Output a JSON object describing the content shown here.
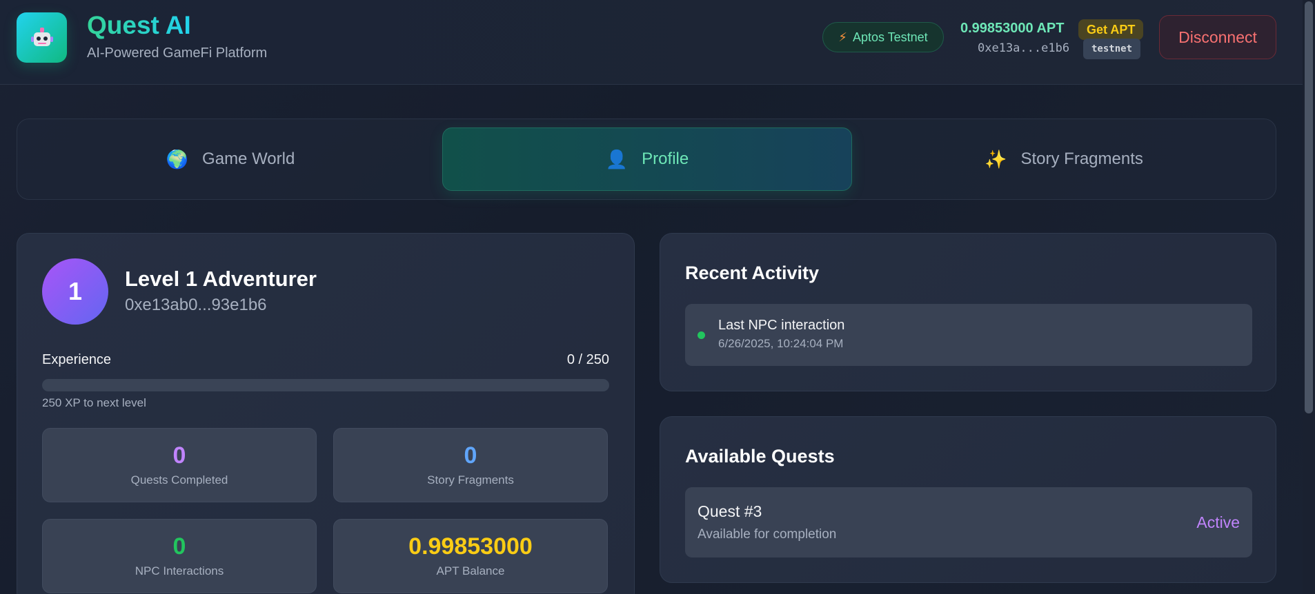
{
  "header": {
    "title": "Quest AI",
    "subtitle": "AI-Powered GameFi Platform",
    "network_badge": "Aptos Testnet",
    "balance": "0.99853000 APT",
    "get_apt": "Get APT",
    "address_short": "0xe13a...e1b6",
    "network_tag": "testnet",
    "disconnect": "Disconnect"
  },
  "tabs": [
    {
      "label": "Game World",
      "icon": "globe-icon"
    },
    {
      "label": "Profile",
      "icon": "user-icon",
      "active": true
    },
    {
      "label": "Story Fragments",
      "icon": "sparkles-icon"
    }
  ],
  "profile": {
    "level_number": "1",
    "level_title": "Level 1 Adventurer",
    "address": "0xe13ab0...93e1b6",
    "experience_label": "Experience",
    "experience_value": "0 / 250",
    "experience_fraction": 0,
    "xp_next": "250 XP to next level",
    "stats": [
      {
        "value": "0",
        "label": "Quests Completed",
        "color": "#c084fc"
      },
      {
        "value": "0",
        "label": "Story Fragments",
        "color": "#60a5fa"
      },
      {
        "value": "0",
        "label": "NPC Interactions",
        "color": "#22c55e"
      },
      {
        "value": "0.99853000",
        "label": "APT Balance",
        "color": "#facc15"
      }
    ]
  },
  "activity": {
    "title": "Recent Activity",
    "items": [
      {
        "title": "Last NPC interaction",
        "time": "6/26/2025, 10:24:04 PM",
        "status_color": "#22c55e"
      }
    ]
  },
  "quests": {
    "title": "Available Quests",
    "items": [
      {
        "title": "Quest #3",
        "subtitle": "Available for completion",
        "status": "Active"
      }
    ]
  }
}
